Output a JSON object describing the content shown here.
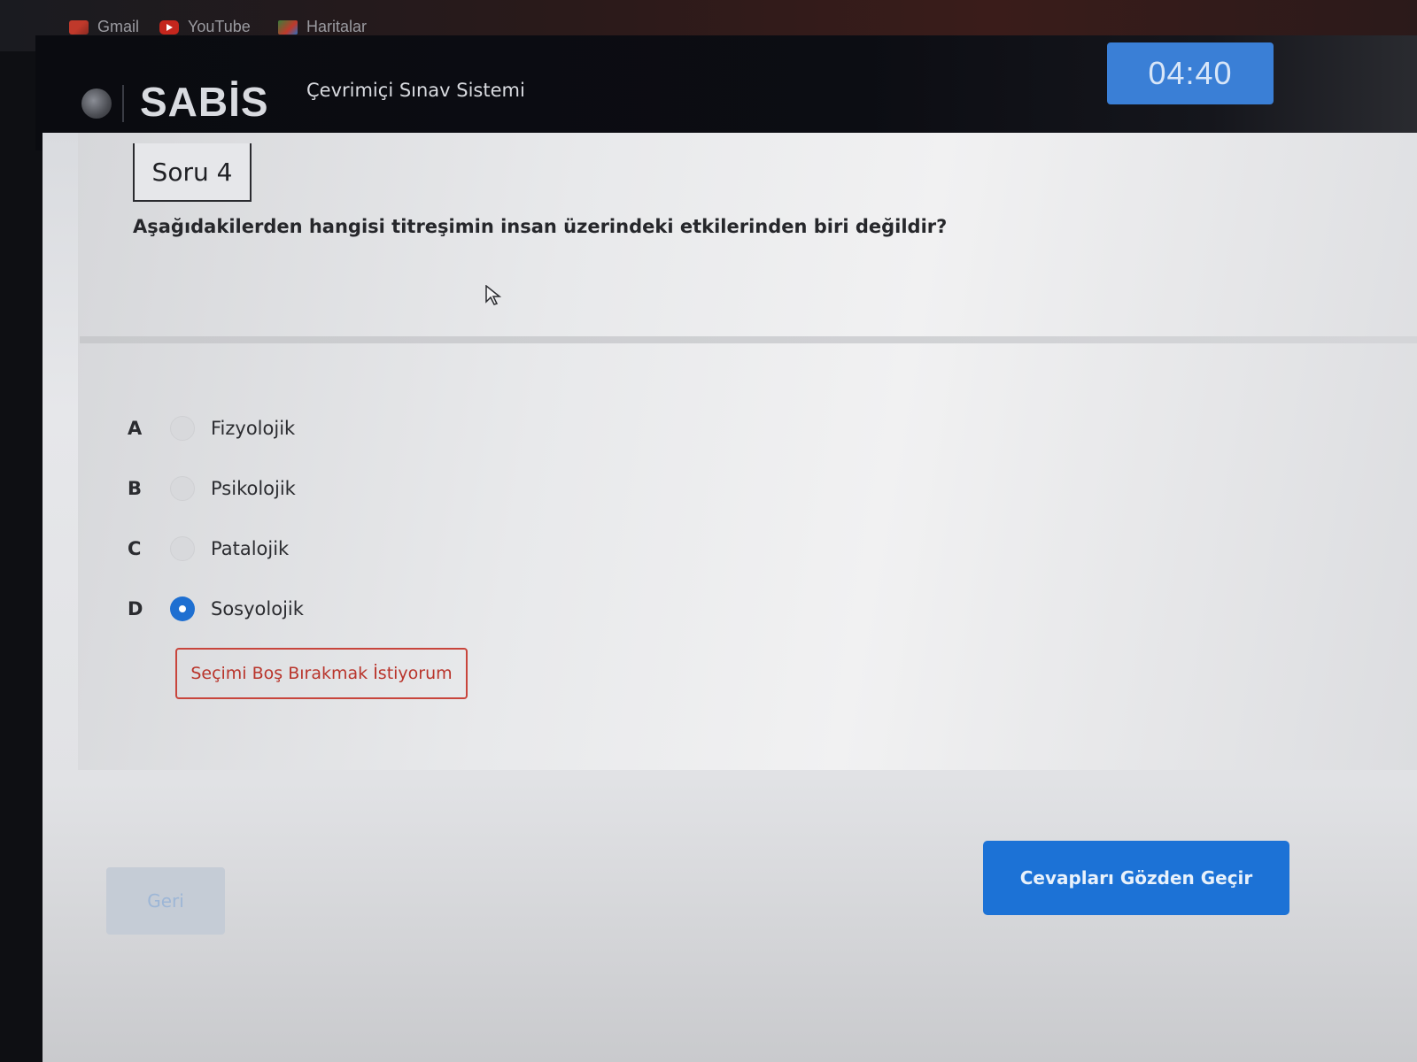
{
  "bookmarks": [
    {
      "label": "Gmail",
      "icon": "gmail-icon"
    },
    {
      "label": "YouTube",
      "icon": "youtube-icon"
    },
    {
      "label": "Haritalar",
      "icon": "maps-icon"
    }
  ],
  "header": {
    "logo": "SABİS",
    "system_title": "Çevrimiçi Sınav Sistemi",
    "timer": "04:40"
  },
  "question": {
    "label": "Soru 4",
    "text": "Aşağıdakilerden hangisi titreşimin insan üzerindeki etkilerinden biri değildir?"
  },
  "options": [
    {
      "letter": "A",
      "text": "Fizyolojik",
      "selected": false
    },
    {
      "letter": "B",
      "text": "Psikolojik",
      "selected": false
    },
    {
      "letter": "C",
      "text": "Patalojik",
      "selected": false
    },
    {
      "letter": "D",
      "text": "Sosyolojik",
      "selected": true
    }
  ],
  "buttons": {
    "leave_blank": "Seçimi Boş Bırakmak İstiyorum",
    "back": "Geri",
    "review": "Cevapları Gözden Geçir"
  },
  "colors": {
    "accent": "#1c72d6",
    "danger": "#c8453c",
    "header_bg": "#0a0b10"
  }
}
